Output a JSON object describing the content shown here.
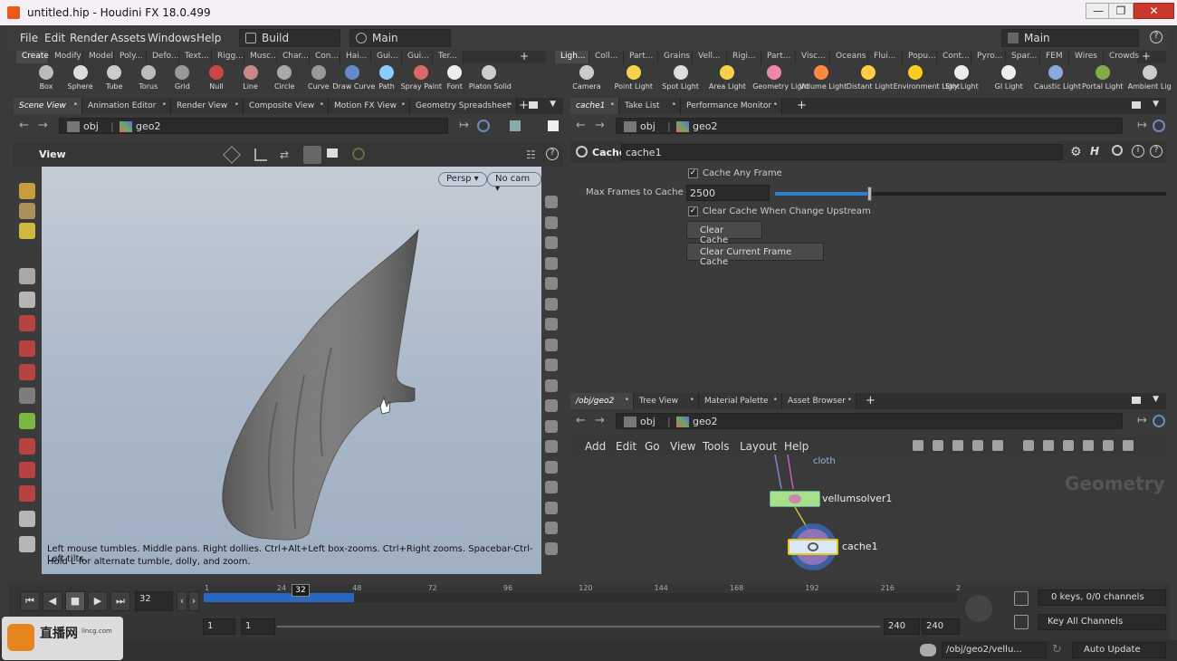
{
  "window": {
    "title": "untitled.hip - Houdini FX 18.0.499",
    "min": "—",
    "max": "❐",
    "close": "✕"
  },
  "menu": {
    "items": [
      "File",
      "Edit",
      "Render",
      "Assets",
      "Windows",
      "Help"
    ],
    "desktop": "Build",
    "desktop2": "Main",
    "right_desktop": "Main"
  },
  "shelf_left": {
    "tabs": [
      "Create",
      "Modify",
      "Model",
      "Poly...",
      "Defo...",
      "Text...",
      "Rigg...",
      "Musc...",
      "Char...",
      "Con...",
      "Hai...",
      "Gui...",
      "Gui...",
      "Ter..."
    ],
    "tools": [
      "Box",
      "Sphere",
      "Tube",
      "Torus",
      "Grid",
      "Null",
      "Line",
      "Circle",
      "Curve",
      "Draw Curve",
      "Path",
      "Spray Paint",
      "Font",
      "Platon Solid"
    ]
  },
  "shelf_right": {
    "tabs": [
      "Ligh...",
      "Coll...",
      "Part...",
      "Grains",
      "Vell...",
      "Rigi...",
      "Part...",
      "Visc...",
      "Oceans",
      "Flui...",
      "Popu...",
      "Cont...",
      "Pyro...",
      "Spar...",
      "FEM",
      "Wires",
      "Crowds"
    ],
    "tools": [
      "Camera",
      "Point Light",
      "Spot Light",
      "Area Light",
      "Geometry Light",
      "Volume Light",
      "Distant Light",
      "Environment Light",
      "Sky Light",
      "GI Light",
      "Caustic Light",
      "Portal Light",
      "Ambient Lig"
    ]
  },
  "left_pane": {
    "tabs": [
      "Scene View",
      "Animation Editor",
      "Render View",
      "Composite View",
      "Motion FX View",
      "Geometry Spreadsheet"
    ],
    "path": [
      "obj",
      "geo2"
    ],
    "view_label": "View",
    "persp": "Persp ▾",
    "cam": "No cam ▾",
    "hint1": "Left mouse tumbles. Middle pans. Right dollies. Ctrl+Alt+Left box-zooms. Ctrl+Right zooms. Spacebar-Ctrl-Left tilts.",
    "hint2": "Hold L for alternate tumble, dolly, and zoom."
  },
  "param_pane": {
    "tabs": [
      "cache1",
      "Take List",
      "Performance Monitor"
    ],
    "path": [
      "obj",
      "geo2"
    ],
    "node_type": "Cache",
    "node_name": "cache1",
    "cache_any_frame": "Cache Any Frame",
    "max_frames_label": "Max Frames to Cache",
    "max_frames_value": "2500",
    "max_frames_fraction": 0.24,
    "clear_upstream": "Clear Cache When Change Upstream",
    "clear_cache": "Clear Cache",
    "clear_current": "Clear Current Frame Cache"
  },
  "network_pane": {
    "tabs": [
      "/obj/geo2",
      "Tree View",
      "Material Palette",
      "Asset Browser"
    ],
    "path": [
      "obj",
      "geo2"
    ],
    "menu": [
      "Add",
      "Edit",
      "Go",
      "View",
      "Tools",
      "Layout",
      "Help"
    ],
    "context_label": "Geometry",
    "nodes": {
      "cloth": "cloth",
      "solver": "vellumsolver1",
      "cache": "cache1"
    }
  },
  "timeline": {
    "current_frame": "32",
    "frame_marker": "32",
    "start": "1",
    "start2": "1",
    "end": "240",
    "end2": "240",
    "ticks": [
      "1",
      "24",
      "48",
      "72",
      "96",
      "120",
      "144",
      "168",
      "192",
      "216",
      "2"
    ],
    "cached_fraction": 0.2,
    "keys_info": "0 keys, 0/0 channels",
    "key_all": "Key All Channels"
  },
  "status": {
    "path": "/obj/geo2/vellu...",
    "update": "Auto Update",
    "watermark": "直播网",
    "watermark_sub": "lincg.com"
  }
}
